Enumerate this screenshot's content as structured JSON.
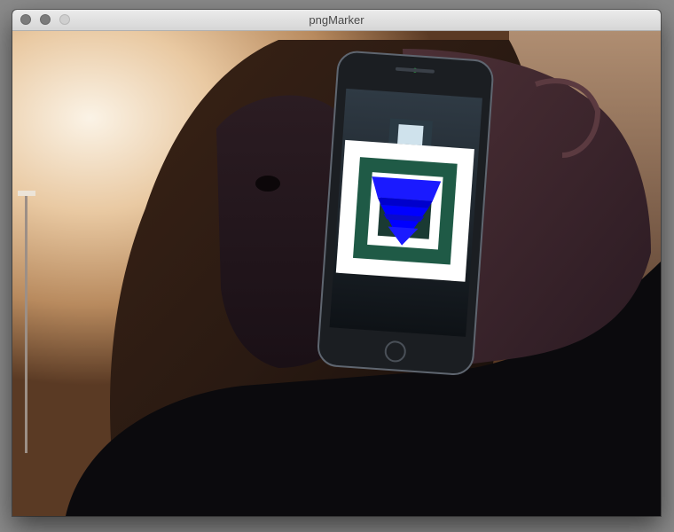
{
  "window": {
    "title": "pngMarker"
  },
  "camera_view": {
    "description_icon": "webcam-feed",
    "marker_colors": {
      "outer": "#ffffff",
      "ring": "#1f5a46",
      "overlay": "#0000ff"
    }
  }
}
